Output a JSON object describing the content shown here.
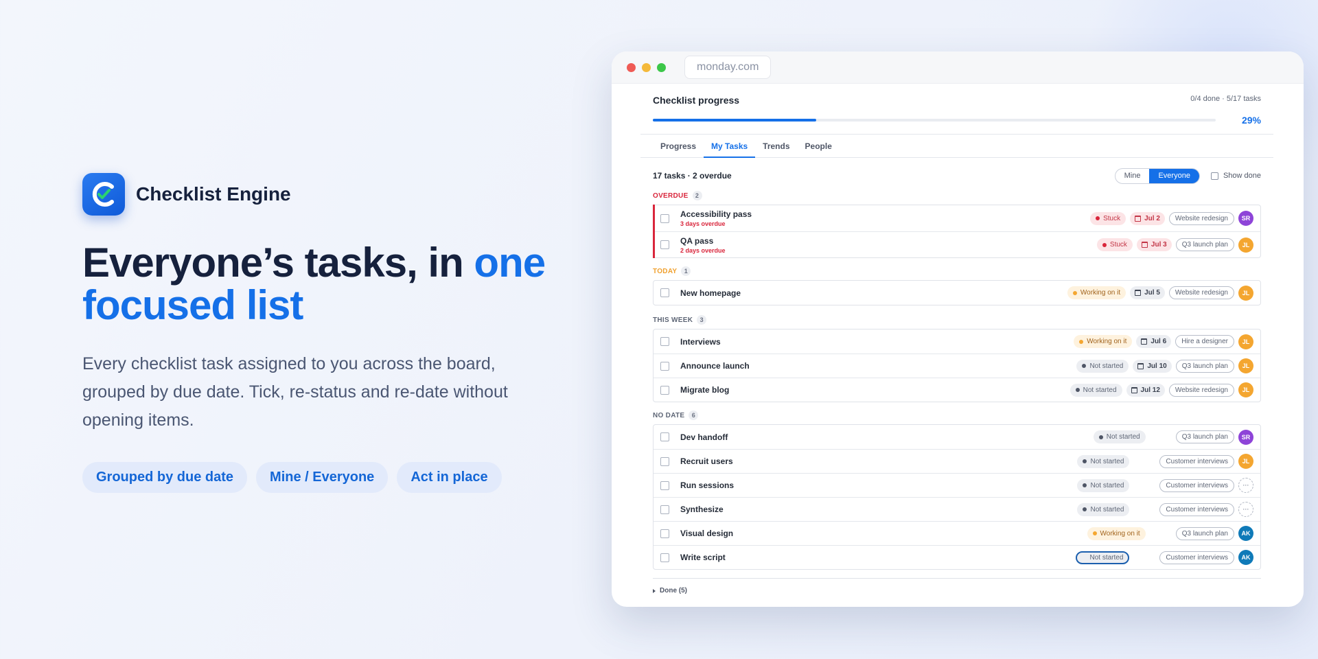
{
  "brand": {
    "name": "Checklist Engine"
  },
  "hero": {
    "headline_part1": "Everyone’s tasks, in ",
    "headline_accent": "one focused list",
    "subtext": "Every checklist task assigned to you across the board, grouped by due date. Tick, re-status and re-date without opening items.",
    "chips": [
      "Grouped by due date",
      "Mine / Everyone",
      "Act in place"
    ]
  },
  "browser": {
    "url": "monday.com"
  },
  "progress": {
    "title": "Checklist progress",
    "meta": "0/4 done · 5/17 tasks",
    "percent_label": "29%",
    "percent": 29
  },
  "tabs": [
    "Progress",
    "My Tasks",
    "Trends",
    "People"
  ],
  "active_tab": 1,
  "toolbar": {
    "count": "17 tasks · 2 overdue",
    "mine_label": "Mine",
    "everyone_label": "Everyone",
    "show_done_label": "Show done"
  },
  "groups": [
    {
      "label": "OVERDUE",
      "count": "2",
      "kind": "overdue",
      "tasks": [
        {
          "name": "Accessibility pass",
          "sub": "3 days overdue",
          "status": "Stuck",
          "status_kind": "stuck",
          "date": "Jul 2",
          "date_kind": "od",
          "board": "Website redesign",
          "avatar": "SR"
        },
        {
          "name": "QA pass",
          "sub": "2 days overdue",
          "status": "Stuck",
          "status_kind": "stuck",
          "date": "Jul 3",
          "date_kind": "od",
          "board": "Q3 launch plan",
          "avatar": "JL"
        }
      ]
    },
    {
      "label": "TODAY",
      "count": "1",
      "kind": "today",
      "tasks": [
        {
          "name": "New homepage",
          "sub": "",
          "status": "Working on it",
          "status_kind": "work",
          "date": "Jul 5",
          "date_kind": "nm",
          "board": "Website redesign",
          "avatar": "JL"
        }
      ]
    },
    {
      "label": "THIS WEEK",
      "count": "3",
      "kind": "week",
      "tasks": [
        {
          "name": "Interviews",
          "sub": "",
          "status": "Working on it",
          "status_kind": "work",
          "date": "Jul 6",
          "date_kind": "nm",
          "board": "Hire a designer",
          "avatar": "JL"
        },
        {
          "name": "Announce launch",
          "sub": "",
          "status": "Not started",
          "status_kind": "not",
          "date": "Jul 10",
          "date_kind": "nm",
          "board": "Q3 launch plan",
          "avatar": "JL"
        },
        {
          "name": "Migrate blog",
          "sub": "",
          "status": "Not started",
          "status_kind": "not",
          "date": "Jul 12",
          "date_kind": "nm",
          "board": "Website redesign",
          "avatar": "JL"
        }
      ]
    },
    {
      "label": "NO DATE",
      "count": "6",
      "kind": "nodate",
      "tasks": [
        {
          "name": "Dev handoff",
          "sub": "",
          "status": "Not started",
          "status_kind": "not",
          "date": "",
          "date_kind": "",
          "board": "Q3 launch plan",
          "avatar": "SR"
        },
        {
          "name": "Recruit users",
          "sub": "",
          "status": "Not started",
          "status_kind": "not",
          "date": "",
          "date_kind": "",
          "board": "Customer interviews",
          "avatar": "JL"
        },
        {
          "name": "Run sessions",
          "sub": "",
          "status": "Not started",
          "status_kind": "not",
          "date": "",
          "date_kind": "",
          "board": "Customer interviews",
          "avatar": "···"
        },
        {
          "name": "Synthesize",
          "sub": "",
          "status": "Not started",
          "status_kind": "not",
          "date": "",
          "date_kind": "",
          "board": "Customer interviews",
          "avatar": "···"
        },
        {
          "name": "Visual design",
          "sub": "",
          "status": "Working on it",
          "status_kind": "work",
          "date": "",
          "date_kind": "",
          "board": "Q3 launch plan",
          "avatar": "AK"
        },
        {
          "name": "Write script",
          "sub": "",
          "status": "Not started",
          "status_kind": "focus",
          "date": "",
          "date_kind": "",
          "board": "Customer interviews",
          "avatar": "AK"
        }
      ]
    }
  ],
  "done_label": "Done (5)",
  "colors": {
    "accent": "#1570e8",
    "overdue": "#d9253b",
    "today": "#f0a02e"
  }
}
